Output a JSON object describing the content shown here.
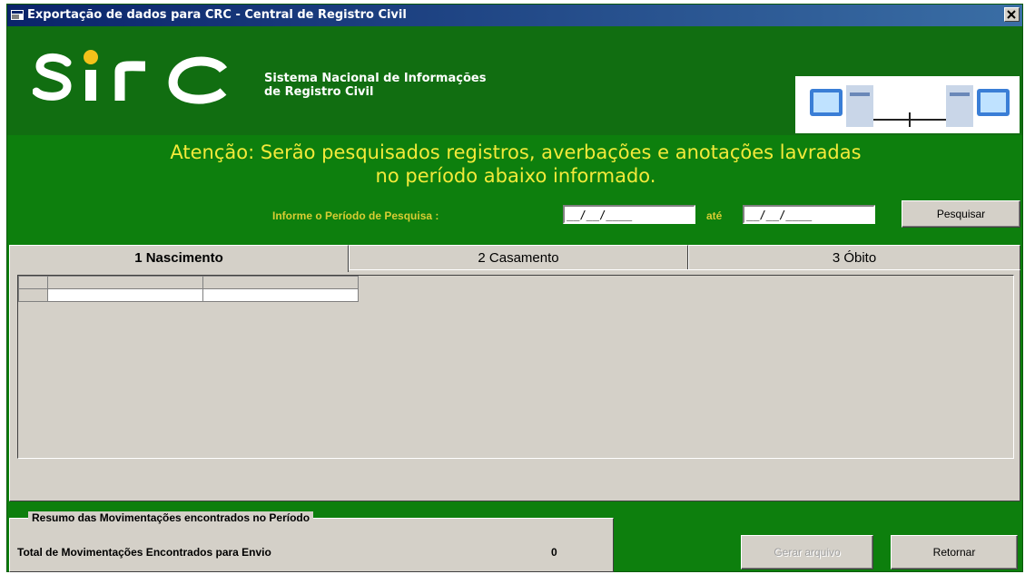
{
  "window": {
    "title": "Exportação de dados para CRC  - Central de Registro Civil",
    "close_symbol": "×"
  },
  "header": {
    "logo_text": "sirc",
    "logo_subtitle_line1": "Sistema Nacional de Informações",
    "logo_subtitle_line2": "de Registro Civil"
  },
  "notice": {
    "line1": "Atenção: Serão pesquisados registros, averbações e anotações lavradas",
    "line2": "no período abaixo informado."
  },
  "search": {
    "period_label": "Informe o Período de Pesquisa :",
    "start_date": "__/__/____",
    "ate_label": "até",
    "end_date": "__/__/____",
    "search_button": "Pesquisar"
  },
  "tabs": [
    {
      "label": "1 Nascimento",
      "active": true
    },
    {
      "label": "2 Casamento",
      "active": false
    },
    {
      "label": "3 Óbito",
      "active": false
    }
  ],
  "summary": {
    "title": "Resumo das Movimentações encontrados no Período",
    "total_label": "Total de Movimentações Encontrados para Envio",
    "total_value": "0"
  },
  "actions": {
    "generate_button": "Gerar arquivo",
    "return_button": "Retornar"
  }
}
